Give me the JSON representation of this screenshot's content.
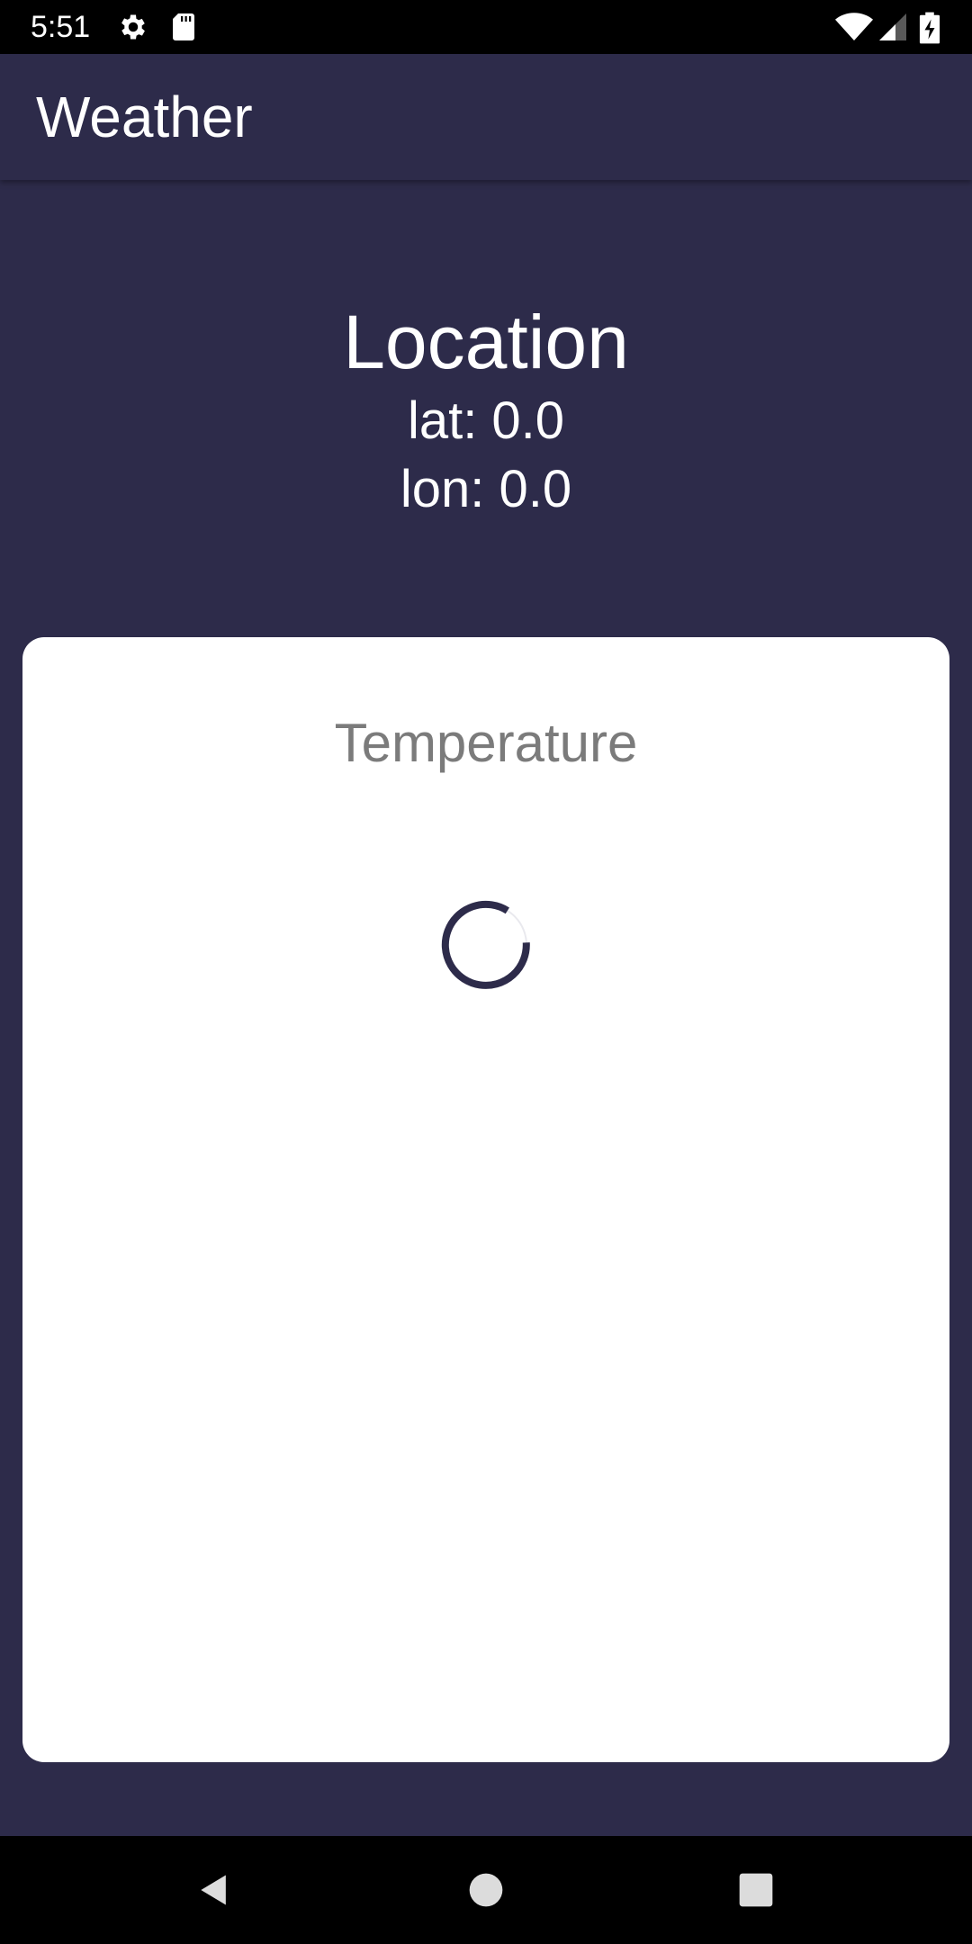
{
  "status_bar": {
    "time": "5:51",
    "icons": [
      "gear-icon",
      "sd-card-icon",
      "wifi-icon",
      "signal-icon",
      "battery-icon"
    ]
  },
  "app_bar": {
    "title": "Weather"
  },
  "location": {
    "title": "Location",
    "lat_line": "lat: 0.0",
    "lon_line": "lon: 0.0"
  },
  "temperature_card": {
    "title": "Temperature",
    "loading_icon": "spinner-icon"
  },
  "nav_bar": {
    "icons": [
      "back-icon",
      "home-icon",
      "recents-icon"
    ]
  },
  "colors": {
    "background": "#2d2b4a",
    "card": "#ffffff",
    "card_title": "#7b7b7b",
    "spinner": "#2d2b4a"
  }
}
